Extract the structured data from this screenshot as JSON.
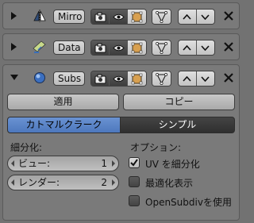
{
  "modifiers": [
    {
      "name": "Mirro",
      "icon": "mirror-modifier-icon",
      "expanded": false
    },
    {
      "name": "Data",
      "icon": "data-transfer-modifier-icon",
      "expanded": false
    },
    {
      "name": "Subs",
      "icon": "subsurf-modifier-icon",
      "expanded": true
    }
  ],
  "subsurf": {
    "apply_label": "適用",
    "copy_label": "コピー",
    "algo_options": [
      "カトマルクラーク",
      "シンプル"
    ],
    "algo_selected": "カトマルクラーク",
    "subdivisions_label": "細分化:",
    "view_label": "ビュー:",
    "view_value": "1",
    "render_label": "レンダー:",
    "render_value": "2",
    "options_label": "オプション:",
    "uv_label": "UV を細分化",
    "uv_checked": true,
    "optimal_label": "最適化表示",
    "optimal_checked": false,
    "opensubdiv_label": "OpenSubdivを使用",
    "opensubdiv_checked": false
  },
  "colors": {
    "selected_blue": "#5680c2",
    "dark_segment": "#3a3a3a",
    "panel_bg": "#7a7a7a"
  }
}
